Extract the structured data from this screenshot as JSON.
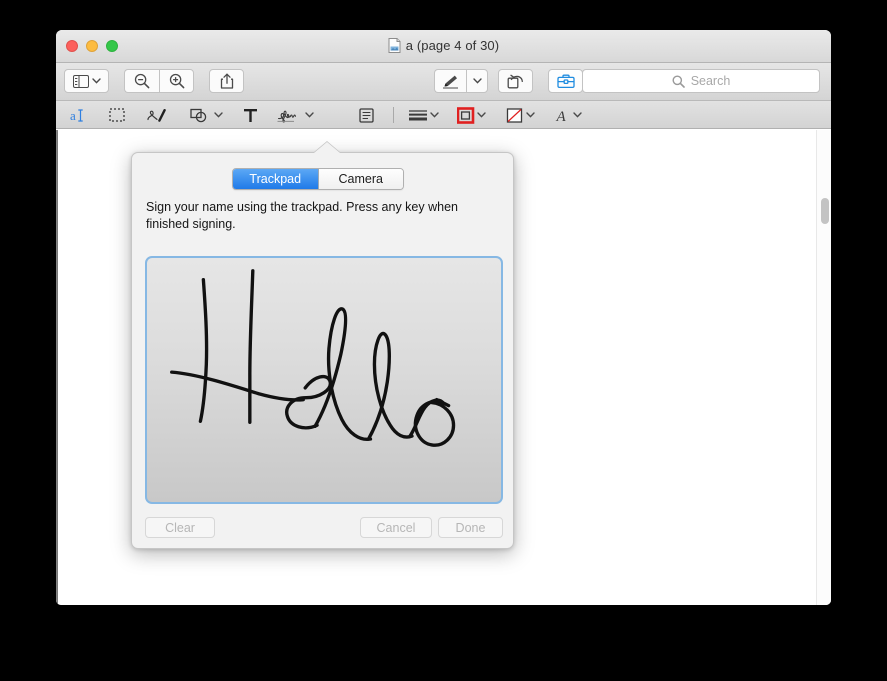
{
  "window": {
    "title": "a (page 4 of 30)",
    "doc_icon": "document-icon",
    "traffic_lights": [
      {
        "name": "close-button",
        "color": "#fc605c"
      },
      {
        "name": "minimize-button",
        "color": "#fdbc40"
      },
      {
        "name": "maximize-button",
        "color": "#34c749"
      }
    ]
  },
  "toolbar": {
    "sidebar_icon": "sidebar-icon",
    "sidebar_chevron": "chevron-down-icon",
    "zoom_out_icon": "zoom-out-icon",
    "zoom_in_icon": "zoom-in-icon",
    "share_icon": "share-icon",
    "markup_icon": "markup-pen-icon",
    "markup_chevron": "chevron-down-icon",
    "rotate_icon": "rotate-left-icon",
    "toolbox_icon": "toolbox-icon",
    "toolbox_active_color": "#1f8ce0",
    "search": {
      "icon": "search-icon",
      "placeholder": "Search",
      "value": ""
    }
  },
  "annotation_toolbar": {
    "items": [
      {
        "name": "text-selection-tool",
        "icon": "text-select-icon",
        "accent": "#2f7fe0"
      },
      {
        "name": "rectangular-selection-tool",
        "icon": "marquee-select-icon",
        "accent": "#555555"
      },
      {
        "name": "sketch-tool",
        "icon": "sketch-icon",
        "accent": "#333333"
      },
      {
        "name": "shapes-tool",
        "icon": "shapes-icon",
        "accent": "#333333"
      },
      {
        "name": "text-tool",
        "icon": "text-t-icon",
        "accent": "#222222"
      },
      {
        "name": "signature-tool",
        "icon": "signature-icon",
        "accent": "#333333"
      },
      {
        "name": "note-tool",
        "icon": "note-icon",
        "accent": "#333333"
      },
      {
        "name": "border-style-tool",
        "icon": "line-weight-icon",
        "accent": "#333333"
      },
      {
        "name": "border-color-tool",
        "icon": "border-color-icon",
        "accent": "#e02020"
      },
      {
        "name": "fill-color-tool",
        "icon": "fill-color-none-icon",
        "accent": "#e02020"
      },
      {
        "name": "text-style-tool",
        "icon": "font-style-icon",
        "accent": "#333333"
      }
    ]
  },
  "popover": {
    "title_arrow": "popover-arrow",
    "segments": [
      {
        "label": "Trackpad",
        "selected": true
      },
      {
        "label": "Camera",
        "selected": false
      }
    ],
    "instruction": "Sign your name using the trackpad. Press any key when finished signing.",
    "signature": {
      "name": "signature-canvas",
      "content": "Hello",
      "stroke_color": "#111111",
      "border_color": "#86b8e4",
      "background_top": "#e6e6e6",
      "background_bottom": "#c8c8c8"
    },
    "buttons": [
      {
        "name": "clear-button",
        "label": "Clear",
        "enabled": false
      },
      {
        "name": "cancel-button",
        "label": "Cancel",
        "enabled": false
      },
      {
        "name": "done-button",
        "label": "Done",
        "enabled": false
      }
    ]
  },
  "document": {
    "scrollbar": "vertical-scrollbar",
    "page_background": "#ffffff"
  }
}
